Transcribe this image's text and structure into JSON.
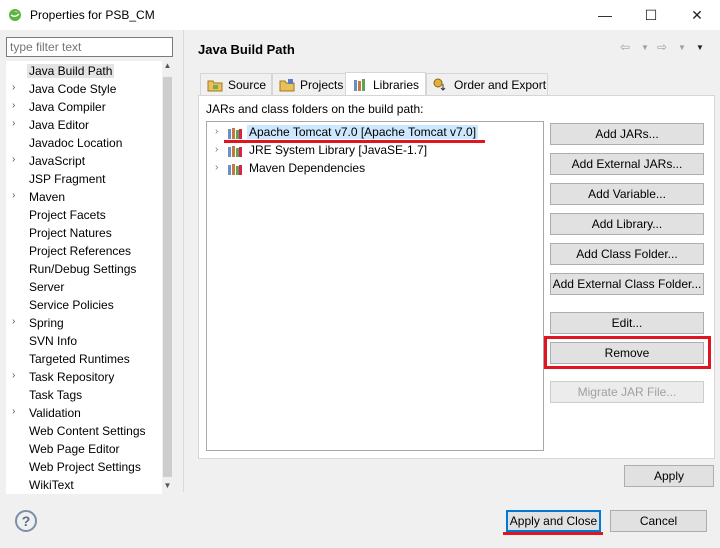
{
  "window": {
    "title": "Properties for PSB_CM",
    "minimize_glyph": "—",
    "maximize_glyph": "☐",
    "close_glyph": "✕"
  },
  "filter": {
    "placeholder": "type filter text"
  },
  "tree": {
    "items": [
      {
        "label": "Java Build Path",
        "expandable": false,
        "selected": true
      },
      {
        "label": "Java Code Style",
        "expandable": true
      },
      {
        "label": "Java Compiler",
        "expandable": true
      },
      {
        "label": "Java Editor",
        "expandable": true
      },
      {
        "label": "Javadoc Location",
        "expandable": false
      },
      {
        "label": "JavaScript",
        "expandable": true
      },
      {
        "label": "JSP Fragment",
        "expandable": false
      },
      {
        "label": "Maven",
        "expandable": true
      },
      {
        "label": "Project Facets",
        "expandable": false
      },
      {
        "label": "Project Natures",
        "expandable": false
      },
      {
        "label": "Project References",
        "expandable": false
      },
      {
        "label": "Run/Debug Settings",
        "expandable": false
      },
      {
        "label": "Server",
        "expandable": false
      },
      {
        "label": "Service Policies",
        "expandable": false
      },
      {
        "label": "Spring",
        "expandable": true
      },
      {
        "label": "SVN Info",
        "expandable": false
      },
      {
        "label": "Targeted Runtimes",
        "expandable": false
      },
      {
        "label": "Task Repository",
        "expandable": true
      },
      {
        "label": "Task Tags",
        "expandable": false
      },
      {
        "label": "Validation",
        "expandable": true
      },
      {
        "label": "Web Content Settings",
        "expandable": false
      },
      {
        "label": "Web Page Editor",
        "expandable": false
      },
      {
        "label": "Web Project Settings",
        "expandable": false
      },
      {
        "label": "WikiText",
        "expandable": false
      }
    ]
  },
  "page": {
    "title": "Java Build Path",
    "tabs": [
      {
        "label": "Source",
        "icon": "source-folder-icon"
      },
      {
        "label": "Projects",
        "icon": "projects-icon"
      },
      {
        "label": "Libraries",
        "icon": "libraries-icon",
        "active": true
      },
      {
        "label": "Order and Export",
        "icon": "order-export-icon"
      }
    ],
    "build_path_label": "JARs and class folders on the build path:",
    "libraries": [
      {
        "label": "Apache Tomcat v7.0 [Apache Tomcat v7.0]",
        "selected": true
      },
      {
        "label": "JRE System Library [JavaSE-1.7]"
      },
      {
        "label": "Maven Dependencies"
      }
    ],
    "buttons": {
      "add_jars": "Add JARs...",
      "add_external_jars": "Add External JARs...",
      "add_variable": "Add Variable...",
      "add_library": "Add Library...",
      "add_class_folder": "Add Class Folder...",
      "add_external_class_folder": "Add External Class Folder...",
      "edit": "Edit...",
      "remove": "Remove",
      "migrate_jar": "Migrate JAR File...",
      "apply": "Apply"
    }
  },
  "footer": {
    "help": "?",
    "apply_and_close": "Apply and Close",
    "cancel": "Cancel"
  },
  "colors": {
    "highlight": "#e0151f",
    "selection": "#cce8ff",
    "default_button_border": "#0078d7"
  }
}
